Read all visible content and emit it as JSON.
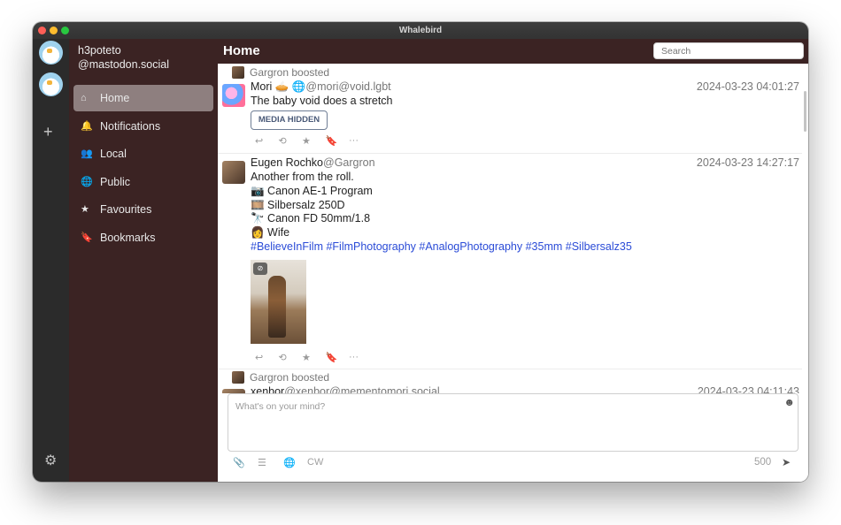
{
  "window": {
    "title": "Whalebird"
  },
  "account": {
    "name": "h3poteto",
    "domain": "@mastodon.social"
  },
  "rail": {
    "add_label": "+",
    "settings_icon": "gear-icon"
  },
  "nav": [
    {
      "label": "Home",
      "icon": "home-icon",
      "glyph": "⌂",
      "active": true
    },
    {
      "label": "Notifications",
      "icon": "bell-icon",
      "glyph": "🔔",
      "active": false
    },
    {
      "label": "Local",
      "icon": "users-icon",
      "glyph": "👥",
      "active": false
    },
    {
      "label": "Public",
      "icon": "globe-icon",
      "glyph": "🌐",
      "active": false
    },
    {
      "label": "Favourites",
      "icon": "star-icon",
      "glyph": "★",
      "active": false
    },
    {
      "label": "Bookmarks",
      "icon": "bookmark-icon",
      "glyph": "🔖",
      "active": false
    }
  ],
  "header": {
    "title": "Home",
    "search_placeholder": "Search"
  },
  "posts": [
    {
      "boosted_by": "Gargron boosted",
      "author": "Mori 🥧 🌐",
      "handle": "@mori@void.lgbt",
      "time": "2024-03-23 04:01:27",
      "text": "The baby void does a stretch",
      "media_button": "MEDIA HIDDEN"
    },
    {
      "author": "Eugen Rochko",
      "handle": "@Gargron",
      "time": "2024-03-23 14:27:17",
      "lines": [
        "Another from the roll.",
        "📷 Canon AE-1 Program",
        "🎞️ Silbersalz 250D",
        "🔭 Canon FD 50mm/1.8",
        "👩 Wife"
      ],
      "tags": "#BelieveInFilm #FilmPhotography #AnalogPhotography #35mm #Silbersalz35"
    },
    {
      "boosted_by": "Gargron boosted",
      "author": "xenbor",
      "handle": "@xenbor@mementomori.social",
      "time": "2024-03-23 04:11:43"
    }
  ],
  "actions": {
    "reply": "↩",
    "boost": "⟲",
    "favourite": "★",
    "bookmark": "🔖",
    "more": "···"
  },
  "composer": {
    "placeholder": "What's on your mind?",
    "cw_label": "CW",
    "char_count": "500"
  }
}
